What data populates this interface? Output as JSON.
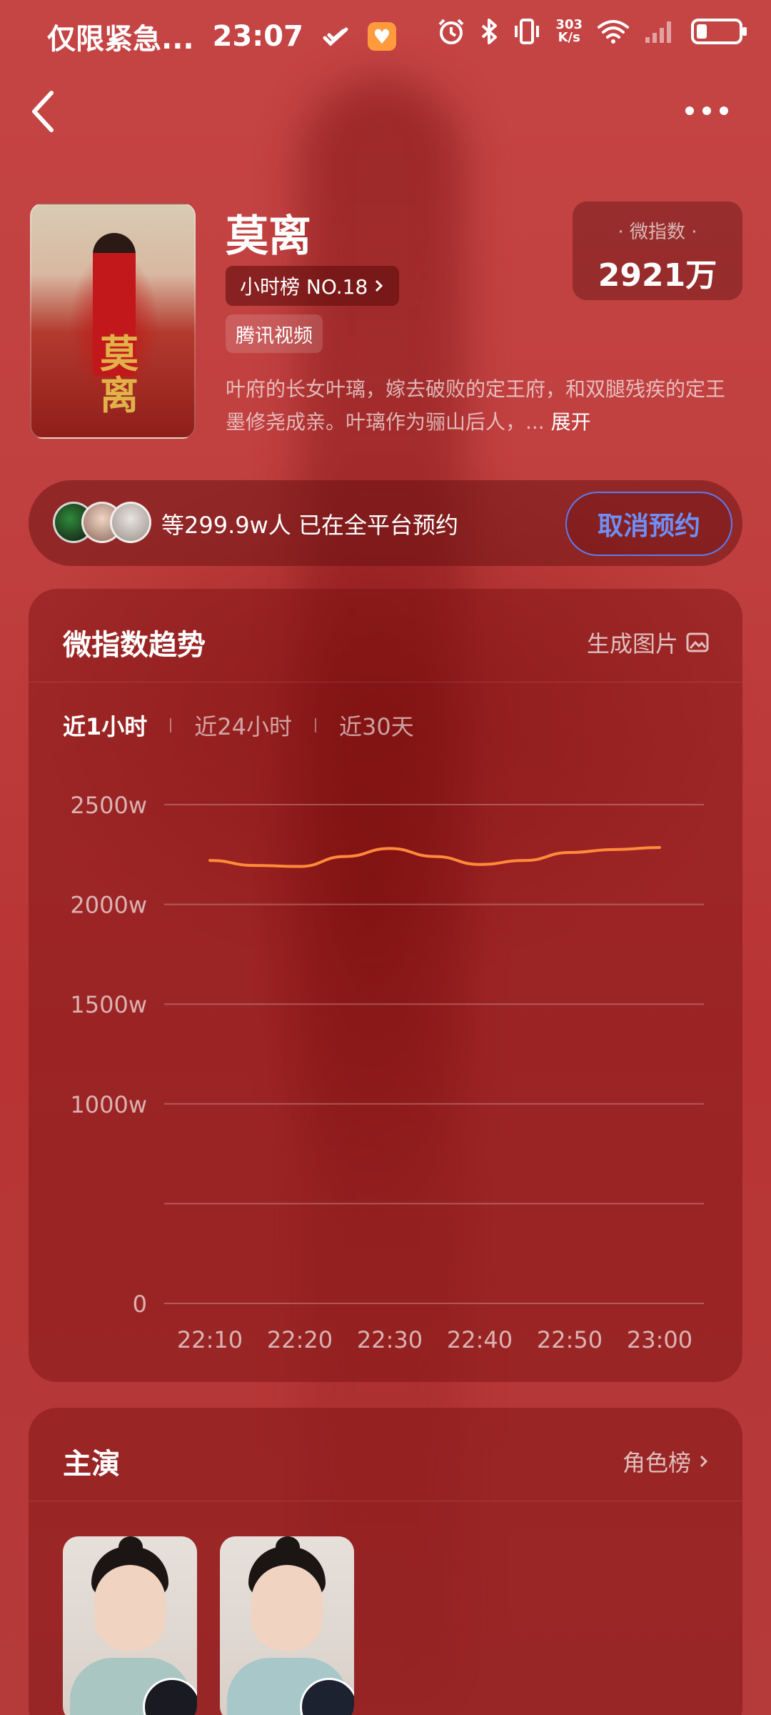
{
  "status_bar": {
    "carrier_text": "仅限紧急...",
    "time": "23:07",
    "net_speed_value": "303",
    "net_speed_unit": "K/s",
    "icons": [
      "check-swirl-icon",
      "heart-app-icon",
      "alarm-icon",
      "bluetooth-icon",
      "vibrate-icon",
      "wifi-icon",
      "signal-icon",
      "battery-icon"
    ]
  },
  "drama": {
    "title": "莫离",
    "rank_label": "小时榜 NO.18",
    "platform": "腾讯视频",
    "index_label": "微指数",
    "index_value": "2921万",
    "synopsis": "叶府的长女叶璃，嫁去破败的定王府，和双腿残疾的定王墨修尧成亲。叶璃作为骊山后人，...",
    "expand_label": "展开",
    "poster_title": "莫离"
  },
  "reservation": {
    "text": "等299.9w人 已在全平台预约",
    "cancel_label": "取消预约"
  },
  "trend": {
    "title": "微指数趋势",
    "action_label": "生成图片",
    "tabs": [
      {
        "label": "近1小时",
        "active": true
      },
      {
        "label": "近24小时",
        "active": false
      },
      {
        "label": "近30天",
        "active": false
      }
    ]
  },
  "chart_data": {
    "type": "line",
    "x": [
      "22:10",
      "22:15",
      "22:20",
      "22:25",
      "22:30",
      "22:35",
      "22:40",
      "22:45",
      "22:50",
      "22:55",
      "23:00"
    ],
    "x_tick_labels": [
      "22:10",
      "22:20",
      "22:30",
      "22:40",
      "22:50",
      "23:00"
    ],
    "series": [
      {
        "values": [
          2220,
          2195,
          2190,
          2240,
          2280,
          2240,
          2200,
          2220,
          2260,
          2275,
          2285
        ],
        "color": "#ff8a3a"
      }
    ],
    "y_tick_labels": [
      "2500w",
      "2000w",
      "1500w",
      "1000w",
      "",
      "0"
    ],
    "y_ticks": [
      2500,
      2000,
      1500,
      1000,
      500,
      0
    ],
    "ylim": [
      0,
      2500
    ],
    "grid": true
  },
  "cast": {
    "title": "主演",
    "action_label": "角色榜"
  },
  "colors": {
    "accent_blue": "#5b7cf0",
    "line_orange": "#ff8a3a"
  }
}
